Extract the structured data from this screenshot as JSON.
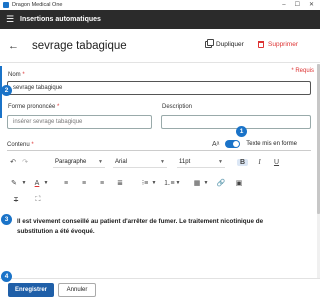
{
  "window": {
    "title": "Dragon Medical One",
    "controls": [
      "–",
      "☐",
      "✕"
    ]
  },
  "appbar": {
    "title": "Insertions automatiques"
  },
  "page": {
    "title": "sevrage tabagique",
    "duplicate_label": "Dupliquer",
    "delete_label": "Supprimer"
  },
  "form": {
    "required_note": "* Requis",
    "name_label": "Nom",
    "name_value": "sevrage tabagique",
    "spoken_label": "Forme prononcée",
    "spoken_placeholder": "insérer sevrage tabagique",
    "description_label": "Description",
    "description_value": "",
    "content_label": "Contenu",
    "formatted_text_label": "Texte mis en forme",
    "formatted_text_on": true
  },
  "editor": {
    "paragraph": "Paragraphe",
    "font": "Arial",
    "size": "11pt",
    "content_lines": [
      "Il est vivement conseillé au patient d'arrêter de fumer. Le traitement nicotinique de",
      "substitution a été évoqué."
    ]
  },
  "footer": {
    "save_label": "Enregistrer",
    "cancel_label": "Annuler"
  },
  "badges": [
    "1",
    "2",
    "3",
    "4"
  ],
  "colors": {
    "accent": "#1a73c8",
    "appbar": "#2b2b2b",
    "danger": "#d33333",
    "save": "#1f5fa8"
  }
}
